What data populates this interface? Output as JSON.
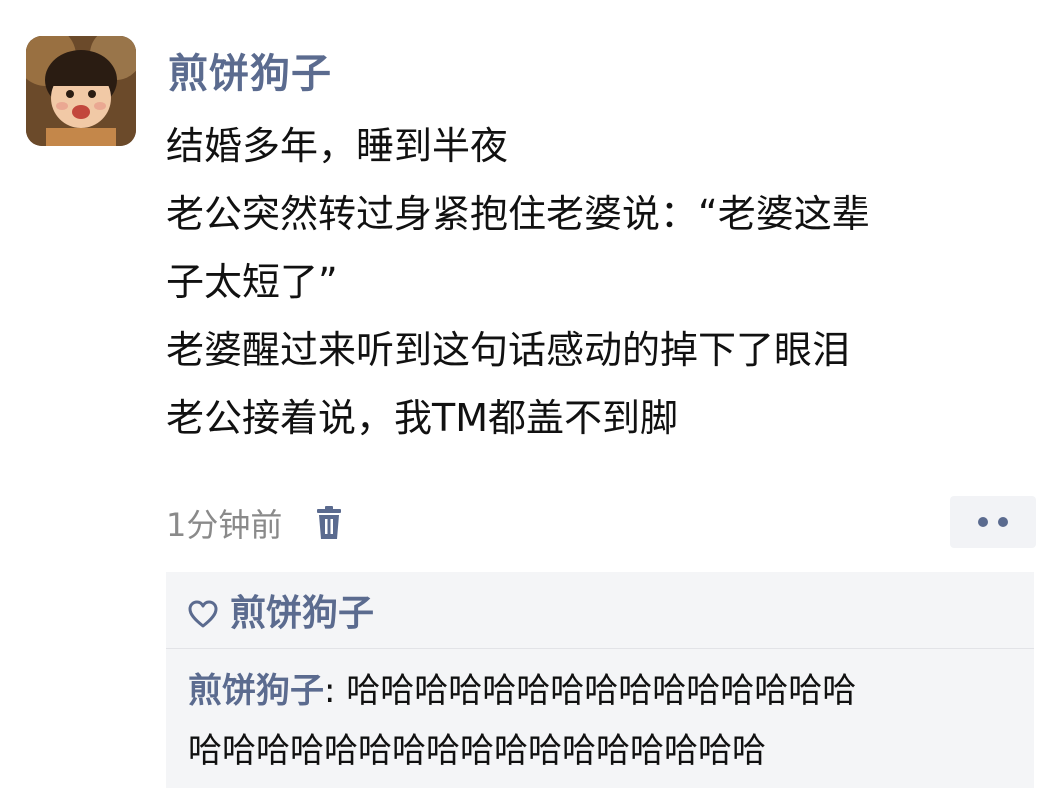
{
  "post": {
    "author": "煎饼狗子",
    "lines": [
      "结婚多年，睡到半夜",
      "老公突然转过身紧抱住老婆说：“老婆这辈",
      "子太短了”",
      "老婆醒过来听到这句话感动的掉下了眼泪",
      "老公接着说，我TM都盖不到脚"
    ],
    "time": "1分钟前",
    "trash_icon": "trash-icon",
    "more_icon": "more-dots-icon"
  },
  "likes": {
    "heart_icon": "heart-outline-icon",
    "names": "煎饼狗子"
  },
  "comment": {
    "author": "煎饼狗子",
    "separator": ": ",
    "line1": "哈哈哈哈哈哈哈哈哈哈哈哈哈哈哈",
    "line2": "哈哈哈哈哈哈哈哈哈哈哈哈哈哈哈哈哈"
  },
  "colors": {
    "name_blue": "#5b6b8f",
    "panel_bg": "#f4f5f7",
    "meta_gray": "#8a8a8a"
  }
}
